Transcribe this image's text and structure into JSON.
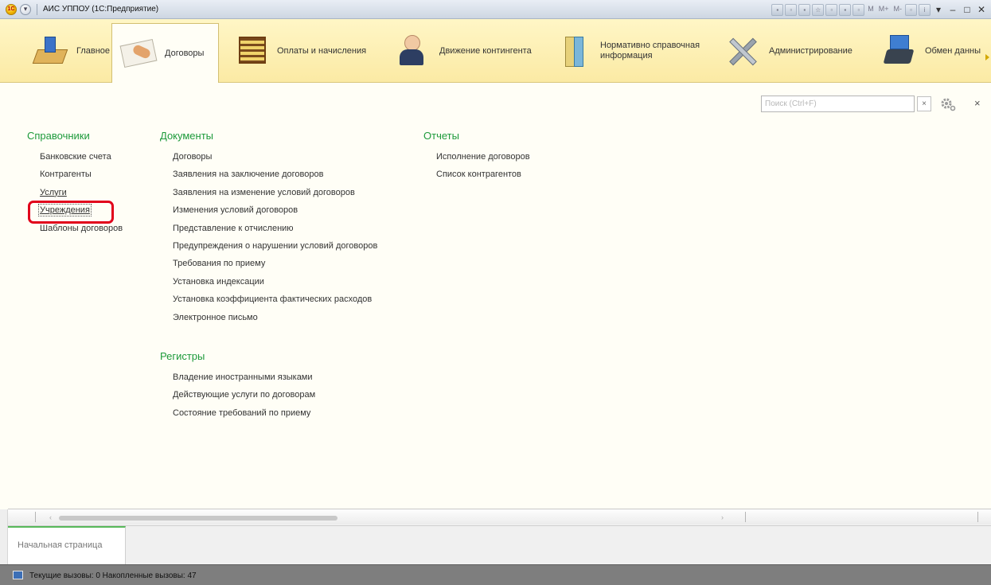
{
  "window": {
    "title": "АИС УППОУ (1С:Предприятие)",
    "toolbar_text": [
      "M",
      "M+",
      "M-"
    ]
  },
  "sections": [
    {
      "label": "Главное",
      "icon": "home-icon"
    },
    {
      "label": "Договоры",
      "icon": "contract-icon",
      "active": true
    },
    {
      "label": "Оплаты и начисления",
      "icon": "abacus-icon"
    },
    {
      "label": "Движение контингента",
      "icon": "person-icon"
    },
    {
      "label": "Нормативно справочная\nинформация",
      "icon": "binder-icon"
    },
    {
      "label": "Администрирование",
      "icon": "tools-icon"
    },
    {
      "label": "Обмен данны",
      "icon": "exchange-icon"
    }
  ],
  "search": {
    "placeholder": "Поиск (Ctrl+F)",
    "value": "",
    "clear_label": "×"
  },
  "close_label": "×",
  "columns": {
    "catalogs": {
      "title": "Справочники",
      "items": [
        "Банковские счета",
        "Контрагенты",
        "Услуги",
        "Учреждения",
        "Шаблоны договоров"
      ]
    },
    "documents": {
      "title": "Документы",
      "items": [
        "Договоры",
        "Заявления на заключение договоров",
        "Заявления на изменение условий договоров",
        "Изменения условий договоров",
        "Представление к отчислению",
        "Предупреждения о нарушении условий договоров",
        "Требования по приему",
        "Установка индексации",
        "Установка коэффициента фактических расходов",
        "Электронное письмо"
      ]
    },
    "registers": {
      "title": "Регистры",
      "items": [
        "Владение иностранными языками",
        "Действующие услуги по договорам",
        "Состояние требований по приему"
      ]
    },
    "reports": {
      "title": "Отчеты",
      "items": [
        "Исполнение договоров",
        "Список контрагентов"
      ]
    }
  },
  "open_windows": {
    "home_tab": "Начальная страница"
  },
  "status": {
    "text": "Текущие вызовы: 0  Накопленные вызовы: 47"
  },
  "colors": {
    "accent_green": "#1d9a3b",
    "section_bg": "#fbeaa4",
    "highlight_red": "#e1001b"
  }
}
